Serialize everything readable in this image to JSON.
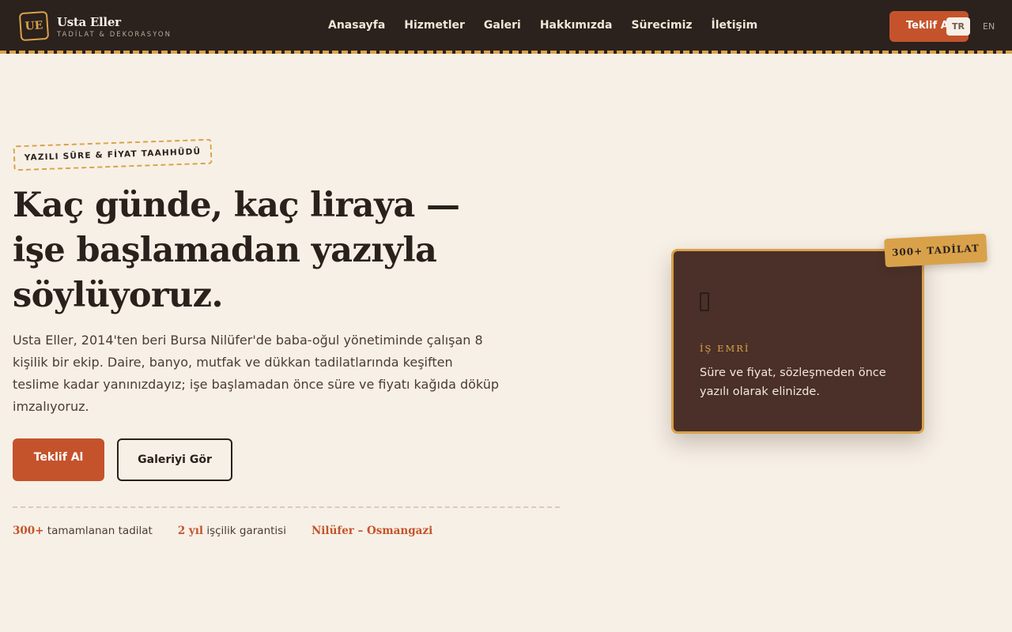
{
  "header": {
    "logo_text": "UE",
    "brand": "Usta Eller",
    "tagline": "TADİLAT & DEKORASYON",
    "nav": [
      "Anasayfa",
      "Hizmetler",
      "Galeri",
      "Hakkımızda",
      "Sürecimiz",
      "İletişim"
    ],
    "cta_label": "Teklif Al",
    "lang_active": "TR",
    "lang_other": "EN"
  },
  "hero": {
    "badge": "YAZILI SÜRE & FİYAT TAAHHÜDÜ",
    "title": "Kaç günde, kaç liraya — işe başlamadan yazıyla söylüyoruz.",
    "text": "Usta Eller, 2014'ten beri Bursa Nilüfer'de baba-oğul yönetiminde çalışan 8 kişilik bir ekip. Daire, banyo, mutfak ve dükkan tadilatlarında keşiften teslime kadar yanınızdayız; işe başlamadan önce süre ve fiyatı kağıda döküp imzalıyoruz.",
    "primary_button": "Teklif Al",
    "secondary_button": "Galeriyi Gör",
    "stats": [
      {
        "value": "300+",
        "label": "tamamlanan tadilat"
      },
      {
        "value": "2 yıl",
        "label": "işçilik garantisi"
      },
      {
        "value": "",
        "label": "Nilüfer – Osmangazi"
      }
    ]
  },
  "card": {
    "icon": "clipboard-icon",
    "label": "İŞ EMRİ",
    "text": "Süre ve fiyat, sözleşmeden önce yazılı olarak elinizde.",
    "ribbon": "300+ TADİLAT"
  },
  "colors": {
    "accent": "#c4532c",
    "gold": "#d9a24a",
    "dark": "#2b211d",
    "background": "#f7f0e6",
    "card": "#4a3028"
  }
}
